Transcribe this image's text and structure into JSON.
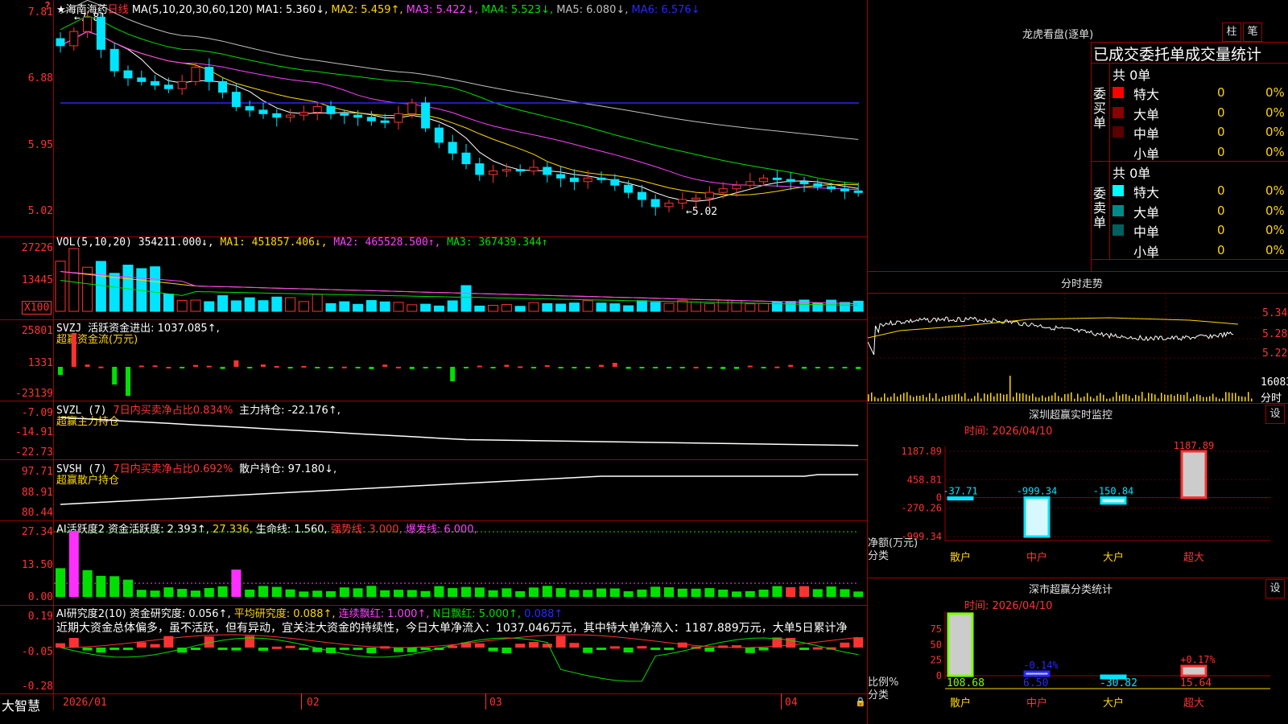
{
  "main": {
    "stock_name": "★海南海药",
    "period": "日线",
    "ma_header": "MA(5,10,20,30,60,120)",
    "ma_values": [
      {
        "label": "MA1: 5.360↓,",
        "color": "#ffffff"
      },
      {
        "label": "MA2: 5.459↑,",
        "color": "#ffd700"
      },
      {
        "label": "MA3: 5.422↓,",
        "color": "#ff40ff"
      },
      {
        "label": "MA4: 5.523↓,",
        "color": "#00e000"
      },
      {
        "label": "MA5: 6.080↓,",
        "color": "#c0c0c0"
      },
      {
        "label": "MA6: 6.576↓",
        "color": "#2828ff"
      }
    ],
    "y_ticks": [
      "7.81",
      "6.88",
      "5.95",
      "5.02"
    ],
    "top_marker": "?",
    "high_label": "←7.81",
    "low_label": "←5.02"
  },
  "vol": {
    "header": "VOL(5,10,20)",
    "value": "354211.000↓,",
    "ma1": "MA1: 451857.406↓,",
    "ma2": "MA2: 465528.500↑,",
    "ma3": "MA3: 367439.344↑",
    "y_ticks": [
      "27226",
      "13445"
    ],
    "unit": "X100"
  },
  "svzj": {
    "header": "SVZJ",
    "label": "活跃资金进出: 1037.085↑,",
    "subtitle": "超赢资金流(万元)",
    "y_ticks": [
      "25801",
      "1331",
      "-23139"
    ]
  },
  "svzl": {
    "header": "SVZL (7)",
    "label1": "7日内买卖净占比0.834%",
    "label2": "主力持仓: -22.176↑,",
    "subtitle": "超赢主力持仓",
    "y_ticks": [
      "-7.09",
      "-14.91",
      "-22.73"
    ]
  },
  "svsh": {
    "header": "SVSH (7)",
    "label1": "7日内买卖净占比0.692%",
    "label2": "散户持仓: 97.180↓,",
    "subtitle": "超赢散户持仓",
    "y_ticks": [
      "97.71",
      "88.91",
      "80.44"
    ]
  },
  "ai1": {
    "header": "AI活跃度2",
    "l1": "资金活跃度: 2.393↑,",
    "l2": "27.336,",
    "l3": "生命线: 1.560,",
    "l4": "强势线: 3.000,",
    "l5": "爆发线: 6.000,",
    "y_ticks": [
      "27.34",
      "13.50",
      "0.00"
    ]
  },
  "ai2": {
    "header": "AI研究度2(10)",
    "l1": "资金研究度: 0.056↑,",
    "l2": "平均研究度: 0.088↑,",
    "l3": "连续飘红: 1.000↑,",
    "l4": "N日飘红: 5.000↑,",
    "l5": "0.088↑",
    "comment": "近期大资金总体偏多，虽不活跃，但有异动，宜关注大资金的持续性，今日大单净流入：1037.046万元，其中特大单净流入：1187.889万元，大单5日累计净",
    "y_ticks": [
      "0.19",
      "-0.05",
      "-0.28"
    ]
  },
  "dates": [
    "2026/01",
    "02",
    "03",
    "04"
  ],
  "brand": "大智慧",
  "right": {
    "lhb_title": "龙虎看盘(逐单)",
    "btn_zhu": "柱",
    "btn_bi": "笔",
    "stat_header": "已成交委托单成交量统计",
    "buy_side": "委买单",
    "sell_side": "委卖单",
    "buy_total": "共 0单",
    "sell_total": "共 0单",
    "buy_rows": [
      {
        "name": "特大",
        "count": "0",
        "pct": "0%",
        "color": "#ff0000"
      },
      {
        "name": "大单",
        "count": "0",
        "pct": "0%",
        "color": "#8b0000"
      },
      {
        "name": "中单",
        "count": "0",
        "pct": "0%",
        "color": "#5a0000"
      },
      {
        "name": "小单",
        "count": "0",
        "pct": "0%",
        "color": "#000000"
      }
    ],
    "sell_rows": [
      {
        "name": "特大",
        "count": "0",
        "pct": "0%",
        "color": "#00ffff"
      },
      {
        "name": "大单",
        "count": "0",
        "pct": "0%",
        "color": "#008b8b"
      },
      {
        "name": "中单",
        "count": "0",
        "pct": "0%",
        "color": "#006060"
      },
      {
        "name": "小单",
        "count": "0",
        "pct": "0%",
        "color": "#000000"
      }
    ],
    "fenshi_title": "分时走势",
    "fenshi_ticks": [
      "5.34",
      "5.28",
      "5.22"
    ],
    "fenshi_vol": "16083",
    "fenshi_label": "分时",
    "sz_monitor_title": "深圳超赢实时监控",
    "sz_set": "设",
    "time1": "时间: 2026/04/10",
    "net_ticks": [
      "1187.89",
      "458.81",
      "0",
      "-270.26",
      "-999.34"
    ],
    "net_unit": "净额(万元)",
    "cat_label": "分类",
    "net_bars": [
      {
        "name": "散户",
        "value": -37.71,
        "label": "-37.71"
      },
      {
        "name": "中户",
        "value": -999.34,
        "label": "-999.34"
      },
      {
        "name": "大户",
        "value": -150.84,
        "label": "-150.84"
      },
      {
        "name": "超大",
        "value": 1187.89,
        "label": "1187.89"
      }
    ],
    "cls_title": "深市超赢分类统计",
    "cls_set": "设",
    "time2": "时间: 2026/04/10",
    "ratio_ticks": [
      "75",
      "50",
      "25",
      "0"
    ],
    "ratio_unit": "比例%",
    "ratio_cat": "分类",
    "ratio_bars": [
      {
        "name": "散户",
        "value": 108.68,
        "label": "108.68",
        "delta": "",
        "color": "#7fff00"
      },
      {
        "name": "中户",
        "value": 6.5,
        "label": "6.50",
        "delta": "-0.14%",
        "color": "#2828ff"
      },
      {
        "name": "大户",
        "value": -30.82,
        "label": "-30.82",
        "delta": "",
        "color": "#00e5ff"
      },
      {
        "name": "超大",
        "value": 15.64,
        "label": "15.64",
        "delta": "+0.17%",
        "color": "#ff3232"
      }
    ]
  }
}
